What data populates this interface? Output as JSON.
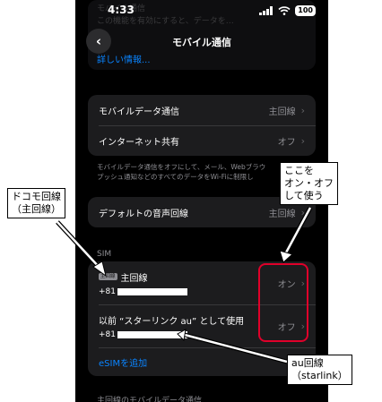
{
  "status_bar": {
    "time": "4:33",
    "battery": "100"
  },
  "top_ghost": {
    "line1": "モバイル通信",
    "line2": "この機能を有効にすると、データを…",
    "line3": ""
  },
  "nav": {
    "title": "モバイル通信",
    "back_icon": "chevron-left-icon",
    "more_info": "詳しい情報..."
  },
  "data_group": {
    "rows": [
      {
        "label": "モバイルデータ通信",
        "value": "主回線"
      },
      {
        "label": "インターネット共有",
        "value": "オフ"
      }
    ]
  },
  "footnote": {
    "line1": "モバイルデータ通信をオフにして、メール、Webブラウ",
    "line2": "プッシュ通知などのすべてのデータをWi-Fiに制限し"
  },
  "voice_group": {
    "label": "デフォルトの音声回線",
    "value": "主回線"
  },
  "sim_section": {
    "header": "SIM",
    "lines": [
      {
        "badge": "主回線",
        "name": "主回線",
        "number_prefix": "+81",
        "value": "オン"
      },
      {
        "badge": "",
        "name": "以前 “スターリンク au” として使用",
        "number_prefix": "+81",
        "value": "オフ"
      }
    ],
    "add_esim": "eSIMを追加"
  },
  "bottom_text": "主回線のモバイルデータ通信",
  "annotations": {
    "docomo": "ドコモ回線\n（主回線）",
    "toggle": "ここを\nオン・オフ\nして使う",
    "au": "au回線\n（starlink）",
    "highlight_color": "#e0002a"
  },
  "colors": {
    "accent": "#0a84ff",
    "background": "#000000",
    "card": "#1c1c1e"
  }
}
